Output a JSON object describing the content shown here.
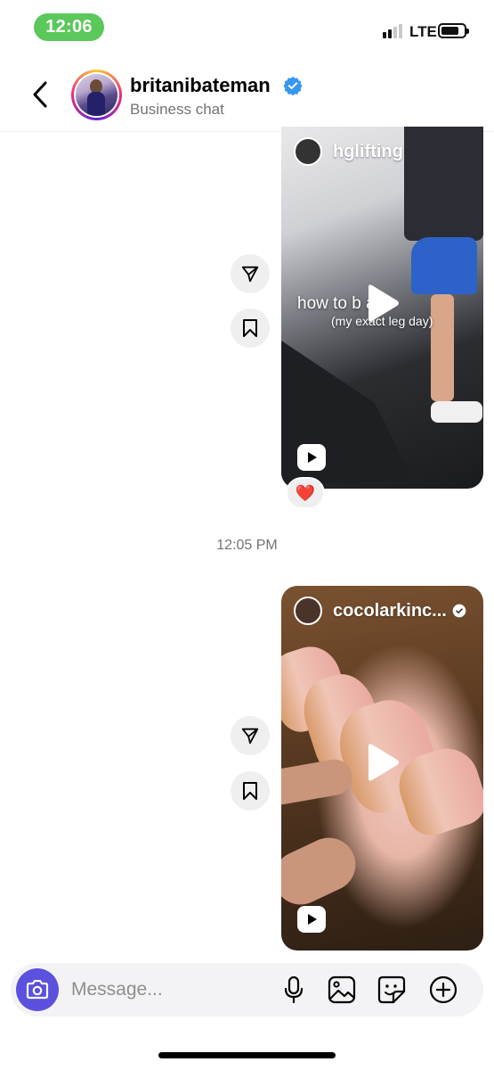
{
  "status_bar": {
    "time": "12:06",
    "network": "LTE",
    "signal_bars_on": 2,
    "signal_bars_total": 4,
    "battery_level": 0.75
  },
  "header": {
    "username": "britanibateman",
    "subtitle": "Business chat",
    "verified": true,
    "back_icon": "chevron-left-icon"
  },
  "messages": [
    {
      "type": "reel",
      "author": "hglifting",
      "caption": "how to b      a",
      "caption_sub": "(my exact leg day)",
      "reaction": "❤️"
    },
    {
      "type": "timestamp",
      "text": "12:05 PM"
    },
    {
      "type": "reel",
      "author": "cocolarkinc...",
      "author_verified": true
    }
  ],
  "composer": {
    "placeholder": "Message...",
    "tools": [
      "microphone-icon",
      "gallery-icon",
      "sticker-icon",
      "plus-icon"
    ]
  },
  "colors": {
    "accent": "#5b51de",
    "verified": "#3897f0",
    "time_pill": "#5ac85a"
  }
}
